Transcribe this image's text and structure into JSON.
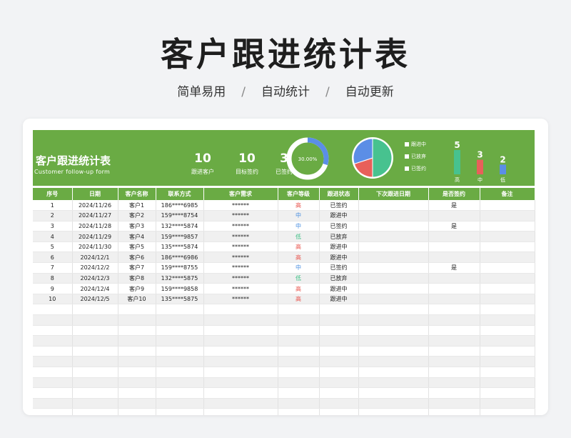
{
  "page": {
    "title": "客户跟进统计表",
    "subtitle_items": [
      "简单易用",
      "自动统计",
      "自动更新"
    ],
    "separator": "/"
  },
  "sheet": {
    "title": "客户跟进统计表",
    "subtitle": "Customer follow-up form",
    "kpis": [
      {
        "value": "10",
        "label": "跟进客户"
      },
      {
        "value": "10",
        "label": "目标签约"
      },
      {
        "value": "3",
        "label": "已签约"
      }
    ],
    "donut": {
      "label": "30.00%",
      "fraction": 0.3
    },
    "pie": {
      "slices": [
        {
          "name": "跟进中",
          "value": 5,
          "color": "#47c28f"
        },
        {
          "name": "已放弃",
          "value": 2,
          "color": "#e8605a"
        },
        {
          "name": "已签约",
          "value": 3,
          "color": "#5b8ee6"
        }
      ]
    },
    "legend": [
      "跟进中",
      "已放弃",
      "已签约"
    ],
    "level_bars": [
      {
        "name": "高",
        "value": 5,
        "color": "#47c28f"
      },
      {
        "name": "中",
        "value": 3,
        "color": "#e8605a"
      },
      {
        "name": "低",
        "value": 2,
        "color": "#5b8ee6"
      }
    ]
  },
  "table": {
    "headers": [
      "序号",
      "日期",
      "客户名称",
      "联系方式",
      "客户需求",
      "客户等级",
      "跟进状态",
      "下次跟进日期",
      "是否签约",
      "备注"
    ],
    "rows": [
      [
        "1",
        "2024/11/26",
        "客户1",
        "186****6985",
        "******",
        "高",
        "已签约",
        "",
        "是",
        ""
      ],
      [
        "2",
        "2024/11/27",
        "客户2",
        "159****8754",
        "******",
        "中",
        "跟进中",
        "",
        "",
        ""
      ],
      [
        "3",
        "2024/11/28",
        "客户3",
        "132****5874",
        "******",
        "中",
        "已签约",
        "",
        "是",
        ""
      ],
      [
        "4",
        "2024/11/29",
        "客户4",
        "159****9857",
        "******",
        "低",
        "已放弃",
        "",
        "",
        ""
      ],
      [
        "5",
        "2024/11/30",
        "客户5",
        "135****5874",
        "******",
        "高",
        "跟进中",
        "",
        "",
        ""
      ],
      [
        "6",
        "2024/12/1",
        "客户6",
        "186****6986",
        "******",
        "高",
        "跟进中",
        "",
        "",
        ""
      ],
      [
        "7",
        "2024/12/2",
        "客户7",
        "159****8755",
        "******",
        "中",
        "已签约",
        "",
        "是",
        ""
      ],
      [
        "8",
        "2024/12/3",
        "客户8",
        "132****5875",
        "******",
        "低",
        "已放弃",
        "",
        "",
        ""
      ],
      [
        "9",
        "2024/12/4",
        "客户9",
        "159****9858",
        "******",
        "高",
        "跟进中",
        "",
        "",
        ""
      ],
      [
        "10",
        "2024/12/5",
        "客户10",
        "135****5875",
        "******",
        "高",
        "跟进中",
        "",
        "",
        ""
      ]
    ],
    "empty_rows": 11
  },
  "colors": {
    "brand_green": "#6aab44",
    "high": "#e8554e",
    "mid": "#4a8fe0",
    "low": "#3bbf84"
  }
}
